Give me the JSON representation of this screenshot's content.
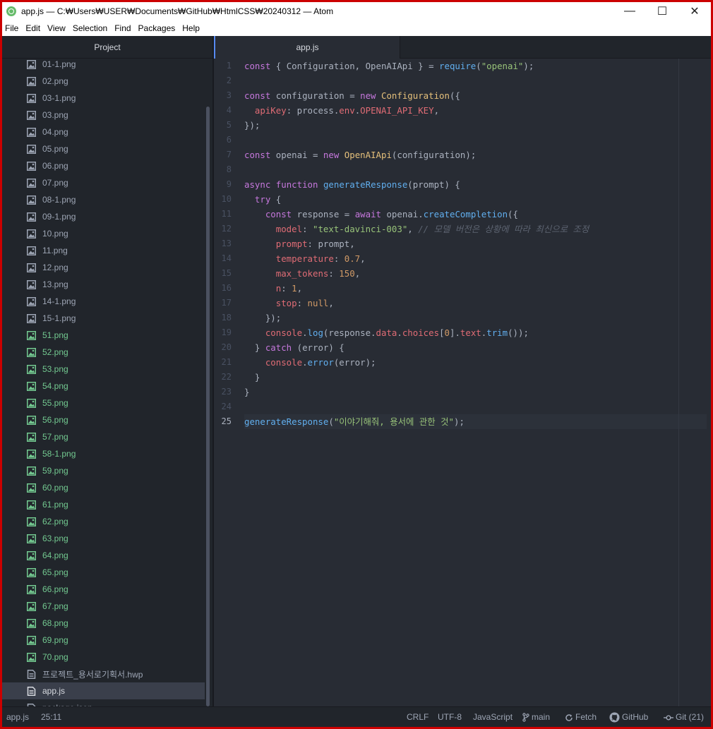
{
  "window": {
    "title": "app.js — C:₩Users₩USER₩Documents₩GitHub₩HtmlCSS₩20240312 — Atom",
    "minimize_glyph": "—",
    "maximize_glyph": "☐",
    "close_glyph": "✕"
  },
  "menu": [
    "File",
    "Edit",
    "View",
    "Selection",
    "Find",
    "Packages",
    "Help"
  ],
  "tree": {
    "header": "Project",
    "files": [
      {
        "name": "01-1.png",
        "status": "clean"
      },
      {
        "name": "02.png",
        "status": "clean"
      },
      {
        "name": "03-1.png",
        "status": "clean"
      },
      {
        "name": "03.png",
        "status": "clean"
      },
      {
        "name": "04.png",
        "status": "clean"
      },
      {
        "name": "05.png",
        "status": "clean"
      },
      {
        "name": "06.png",
        "status": "clean"
      },
      {
        "name": "07.png",
        "status": "clean"
      },
      {
        "name": "08-1.png",
        "status": "clean"
      },
      {
        "name": "09-1.png",
        "status": "clean"
      },
      {
        "name": "10.png",
        "status": "clean"
      },
      {
        "name": "11.png",
        "status": "clean"
      },
      {
        "name": "12.png",
        "status": "clean"
      },
      {
        "name": "13.png",
        "status": "clean"
      },
      {
        "name": "14-1.png",
        "status": "clean"
      },
      {
        "name": "15-1.png",
        "status": "clean"
      },
      {
        "name": "51.png",
        "status": "added"
      },
      {
        "name": "52.png",
        "status": "added"
      },
      {
        "name": "53.png",
        "status": "added"
      },
      {
        "name": "54.png",
        "status": "added"
      },
      {
        "name": "55.png",
        "status": "added"
      },
      {
        "name": "56.png",
        "status": "added"
      },
      {
        "name": "57.png",
        "status": "added"
      },
      {
        "name": "58-1.png",
        "status": "added"
      },
      {
        "name": "59.png",
        "status": "added"
      },
      {
        "name": "60.png",
        "status": "added"
      },
      {
        "name": "61.png",
        "status": "added"
      },
      {
        "name": "62.png",
        "status": "added"
      },
      {
        "name": "63.png",
        "status": "added"
      },
      {
        "name": "64.png",
        "status": "added"
      },
      {
        "name": "65.png",
        "status": "added"
      },
      {
        "name": "66.png",
        "status": "added"
      },
      {
        "name": "67.png",
        "status": "added"
      },
      {
        "name": "68.png",
        "status": "added"
      },
      {
        "name": "69.png",
        "status": "added"
      },
      {
        "name": "70.png",
        "status": "added"
      },
      {
        "name": "프로젝트_용서로기획서.hwp",
        "status": "clean",
        "icon": "file"
      },
      {
        "name": "app.js",
        "status": "clean",
        "icon": "file",
        "selected": true
      },
      {
        "name": "package.json",
        "status": "clean",
        "icon": "file"
      }
    ]
  },
  "editor": {
    "tab_title": "app.js",
    "cursor_line": 25,
    "lines": [
      [
        [
          "kw",
          "const"
        ],
        [
          "t",
          " { Configuration, OpenAIApi } = "
        ],
        [
          "fn",
          "require"
        ],
        [
          "t",
          "("
        ],
        [
          "str",
          "\"openai\""
        ],
        [
          "t",
          ");"
        ]
      ],
      [],
      [
        [
          "kw",
          "const"
        ],
        [
          "t",
          " configuration = "
        ],
        [
          "kw",
          "new"
        ],
        [
          "t",
          " "
        ],
        [
          "cls",
          "Configuration"
        ],
        [
          "t",
          "({"
        ]
      ],
      [
        [
          "t",
          "  "
        ],
        [
          "prop",
          "apiKey"
        ],
        [
          "t",
          ": process."
        ],
        [
          "prop",
          "env"
        ],
        [
          "t",
          "."
        ],
        [
          "prop",
          "OPENAI_API_KEY"
        ],
        [
          "t",
          ","
        ]
      ],
      [
        [
          "t",
          "});"
        ]
      ],
      [],
      [
        [
          "kw",
          "const"
        ],
        [
          "t",
          " openai = "
        ],
        [
          "kw",
          "new"
        ],
        [
          "t",
          " "
        ],
        [
          "cls",
          "OpenAIApi"
        ],
        [
          "t",
          "(configuration);"
        ]
      ],
      [],
      [
        [
          "kw",
          "async"
        ],
        [
          "t",
          " "
        ],
        [
          "kw",
          "function"
        ],
        [
          "t",
          " "
        ],
        [
          "fn",
          "generateResponse"
        ],
        [
          "t",
          "(prompt) {"
        ]
      ],
      [
        [
          "t",
          "  "
        ],
        [
          "kw",
          "try"
        ],
        [
          "t",
          " {"
        ]
      ],
      [
        [
          "t",
          "    "
        ],
        [
          "kw",
          "const"
        ],
        [
          "t",
          " response = "
        ],
        [
          "kw",
          "await"
        ],
        [
          "t",
          " openai."
        ],
        [
          "fn",
          "createCompletion"
        ],
        [
          "t",
          "({"
        ]
      ],
      [
        [
          "t",
          "      "
        ],
        [
          "prop",
          "model"
        ],
        [
          "t",
          ": "
        ],
        [
          "str",
          "\"text-davinci-003\""
        ],
        [
          "t",
          ", "
        ],
        [
          "cm",
          "// 모델 버전은 상황에 따라 최신으로 조정"
        ]
      ],
      [
        [
          "t",
          "      "
        ],
        [
          "prop",
          "prompt"
        ],
        [
          "t",
          ": prompt,"
        ]
      ],
      [
        [
          "t",
          "      "
        ],
        [
          "prop",
          "temperature"
        ],
        [
          "t",
          ": "
        ],
        [
          "num",
          "0.7"
        ],
        [
          "t",
          ","
        ]
      ],
      [
        [
          "t",
          "      "
        ],
        [
          "prop",
          "max_tokens"
        ],
        [
          "t",
          ": "
        ],
        [
          "num",
          "150"
        ],
        [
          "t",
          ","
        ]
      ],
      [
        [
          "t",
          "      "
        ],
        [
          "prop",
          "n"
        ],
        [
          "t",
          ": "
        ],
        [
          "num",
          "1"
        ],
        [
          "t",
          ","
        ]
      ],
      [
        [
          "t",
          "      "
        ],
        [
          "prop",
          "stop"
        ],
        [
          "t",
          ": "
        ],
        [
          "const",
          "null"
        ],
        [
          "t",
          ","
        ]
      ],
      [
        [
          "t",
          "    });"
        ]
      ],
      [
        [
          "t",
          "    "
        ],
        [
          "prop",
          "console"
        ],
        [
          "t",
          "."
        ],
        [
          "fn",
          "log"
        ],
        [
          "t",
          "(response."
        ],
        [
          "prop",
          "data"
        ],
        [
          "t",
          "."
        ],
        [
          "prop",
          "choices"
        ],
        [
          "t",
          "["
        ],
        [
          "num",
          "0"
        ],
        [
          "t",
          "]."
        ],
        [
          "prop",
          "text"
        ],
        [
          "t",
          "."
        ],
        [
          "fn",
          "trim"
        ],
        [
          "t",
          "());"
        ]
      ],
      [
        [
          "t",
          "  } "
        ],
        [
          "kw",
          "catch"
        ],
        [
          "t",
          " (error) {"
        ]
      ],
      [
        [
          "t",
          "    "
        ],
        [
          "prop",
          "console"
        ],
        [
          "t",
          "."
        ],
        [
          "fn",
          "error"
        ],
        [
          "t",
          "(error);"
        ]
      ],
      [
        [
          "t",
          "  }"
        ]
      ],
      [
        [
          "t",
          "}"
        ]
      ],
      [],
      [
        [
          "fn",
          "generateResponse"
        ],
        [
          "t",
          "("
        ],
        [
          "str",
          "\"이야기해줘, 용서에 관한 것\""
        ],
        [
          "t",
          ");"
        ]
      ]
    ]
  },
  "status": {
    "file": "app.js",
    "cursor": "25:11",
    "line_ending": "CRLF",
    "encoding": "UTF-8",
    "grammar": "JavaScript",
    "branch": "main",
    "fetch": "Fetch",
    "github": "GitHub",
    "git": "Git (21)"
  },
  "colors": {
    "added": "#73c990",
    "keyword": "#c678dd",
    "function": "#61afef",
    "string": "#98c379",
    "property": "#e06c75",
    "number": "#d19a66",
    "class": "#e5c07b",
    "comment": "#5c6370"
  }
}
